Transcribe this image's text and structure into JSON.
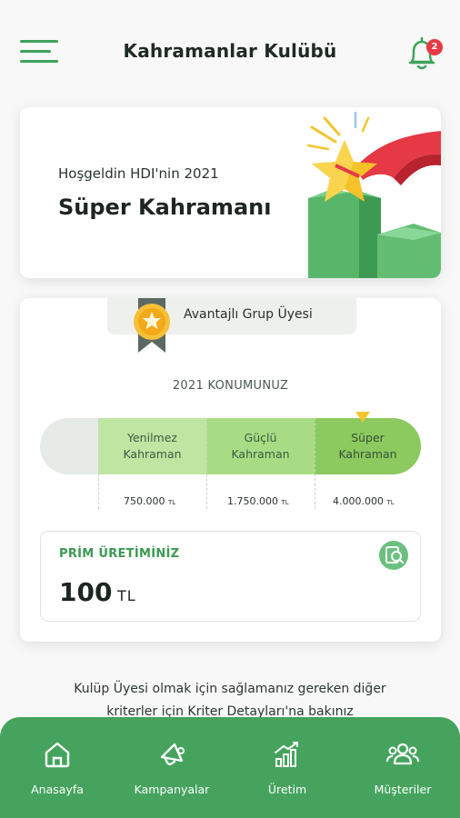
{
  "header": {
    "title": "Kahramanlar Kulübü",
    "notification_count": "2",
    "menu_icon": "hamburger-menu-icon",
    "bell_icon": "bell-icon"
  },
  "hero": {
    "greeting": "Hoşgeldin HDI'nin 2021",
    "headline": "Süper Kahramanı"
  },
  "status": {
    "membership": "Avantajlı Grup Üyesi",
    "position_title": "2021 KONUMUNUZ",
    "current_level_index": 3,
    "levels": [
      {
        "line1": "Yenilmez",
        "line2": "Kahraman",
        "amount": "750.000",
        "unit": "TL"
      },
      {
        "line1": "Güçlü",
        "line2": "Kahraman",
        "amount": "1.750.000",
        "unit": "TL"
      },
      {
        "line1": "Süper",
        "line2": "Kahraman",
        "amount": "4.000.000",
        "unit": "TL"
      }
    ],
    "prim": {
      "label": "PRİM ÜRETİMİNİZ",
      "value": "100",
      "unit": "TL"
    }
  },
  "note": {
    "line1": "Kulüp Üyesi olmak için sağlamanız gereken diğer",
    "line2": "kriterler için Kriter Detayları'na bakınız"
  },
  "tabs": [
    {
      "label": "Anasayfa",
      "icon": "home-icon"
    },
    {
      "label": "Kampanyalar",
      "icon": "megaphone-icon"
    },
    {
      "label": "Üretim",
      "icon": "chart-growth-icon"
    },
    {
      "label": "Müşteriler",
      "icon": "users-icon"
    }
  ],
  "colors": {
    "primary_green": "#45a35e",
    "badge_red": "#e53946",
    "marker_yellow": "#f2c52d"
  }
}
